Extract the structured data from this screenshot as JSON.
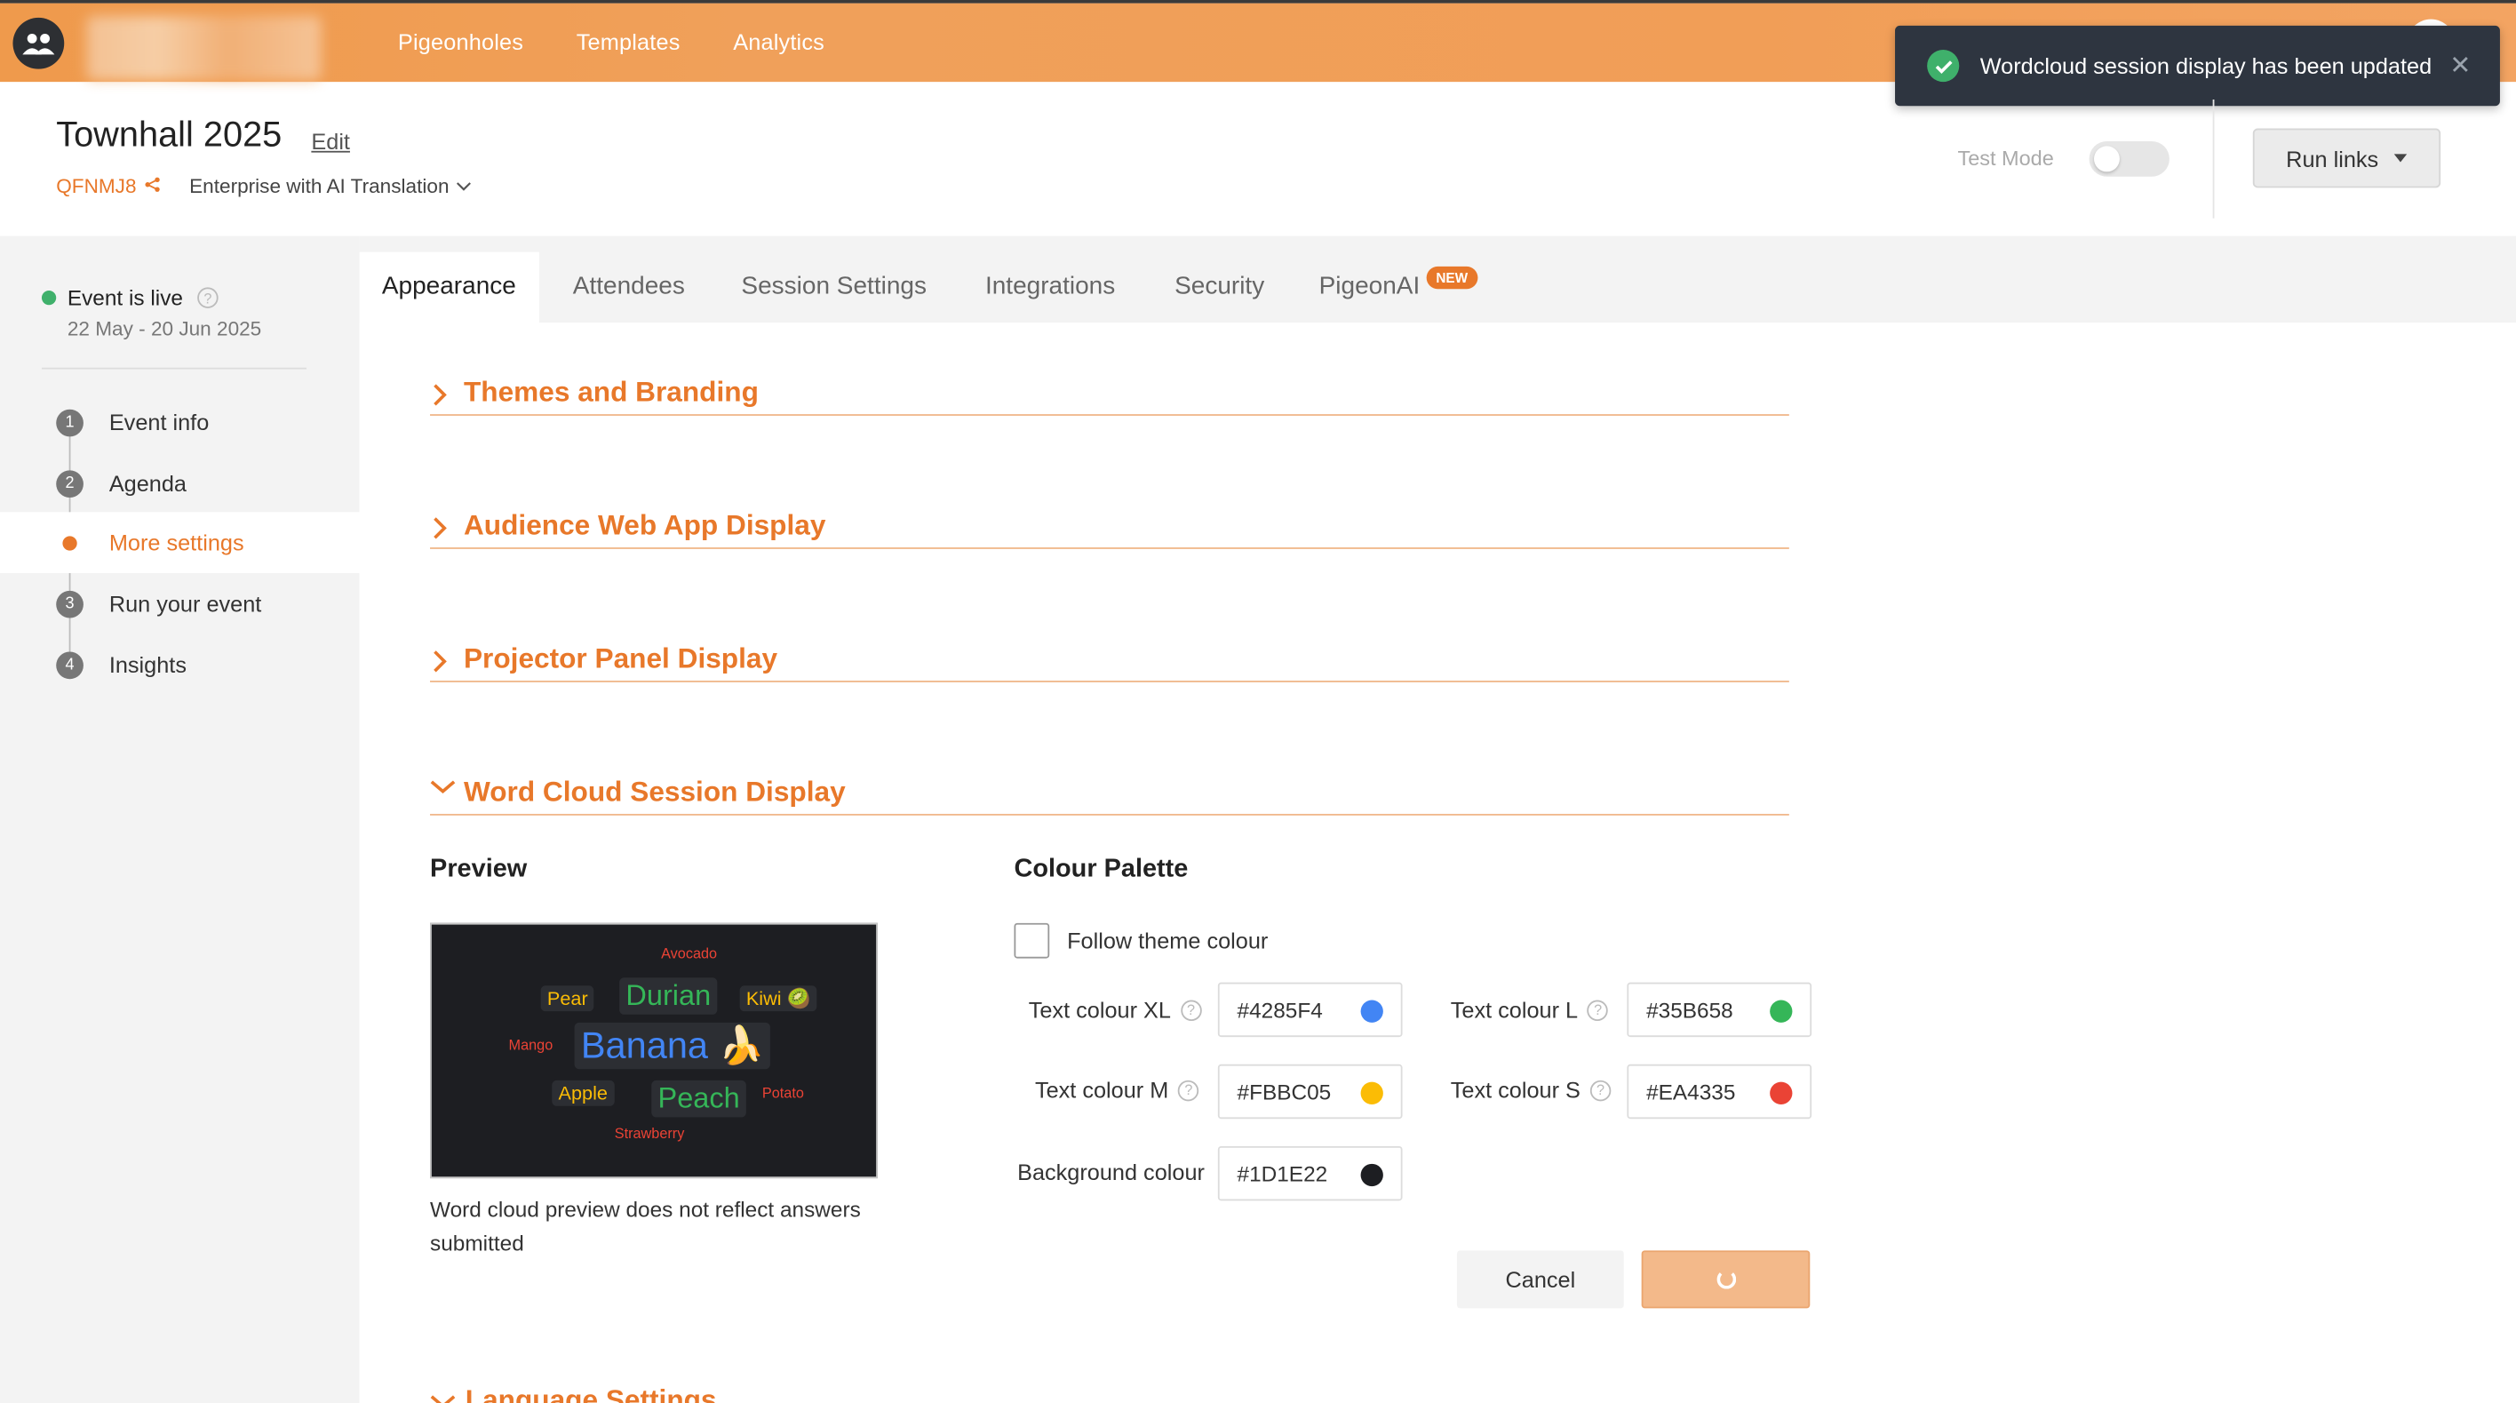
{
  "nav": {
    "items": [
      "Pigeonholes",
      "Templates",
      "Analytics"
    ]
  },
  "toast": {
    "message": "Wordcloud session display has been updated",
    "close": "✕"
  },
  "header": {
    "title": "Townhall 2025",
    "edit": "Edit",
    "code": "QFNMJ8",
    "plan": "Enterprise with AI Translation",
    "test_mode": "Test Mode",
    "test_mode_on": false,
    "run_links": "Run links"
  },
  "sidebar": {
    "status": "Event is live",
    "dates": "22 May - 20 Jun 2025",
    "steps": [
      {
        "num": "1",
        "label": "Event info"
      },
      {
        "num": "2",
        "label": "Agenda"
      },
      {
        "num": "",
        "label": "More settings"
      },
      {
        "num": "3",
        "label": "Run your event"
      },
      {
        "num": "4",
        "label": "Insights"
      }
    ]
  },
  "tabs": [
    {
      "label": "Appearance"
    },
    {
      "label": "Attendees"
    },
    {
      "label": "Session Settings"
    },
    {
      "label": "Integrations"
    },
    {
      "label": "Security"
    },
    {
      "label": "PigeonAI",
      "badge": "NEW"
    }
  ],
  "sections": [
    {
      "title": "Themes and Branding",
      "expanded": false
    },
    {
      "title": "Audience Web App Display",
      "expanded": false
    },
    {
      "title": "Projector Panel Display",
      "expanded": false
    },
    {
      "title": "Word Cloud Session Display",
      "expanded": true
    },
    {
      "title": "Language Settings",
      "expanded": true
    }
  ],
  "wordcloud": {
    "preview_title": "Preview",
    "note": "Word cloud preview does not reflect answers submitted",
    "words": {
      "avocado": "Avocado",
      "pear": "Pear",
      "durian": "Durian",
      "kiwi": "Kiwi 🥝",
      "mango": "Mango",
      "banana": "Banana 🍌",
      "apple": "Apple",
      "peach": "Peach",
      "potato": "Potato",
      "strawberry": "Strawberry"
    }
  },
  "palette": {
    "title": "Colour Palette",
    "follow_theme": "Follow theme colour",
    "follow_theme_checked": false,
    "fields": {
      "xl": {
        "label": "Text colour XL",
        "value": "#4285F4",
        "color": "#4285F4"
      },
      "l": {
        "label": "Text colour L",
        "value": "#35B658",
        "color": "#35B658"
      },
      "m": {
        "label": "Text colour M",
        "value": "#FBBC05",
        "color": "#FBBC05"
      },
      "s": {
        "label": "Text colour S",
        "value": "#EA4335",
        "color": "#EA4335"
      },
      "bg": {
        "label": "Background colour",
        "value": "#1D1E22",
        "color": "#1D1E22"
      }
    },
    "cancel": "Cancel"
  },
  "colors": {
    "brand": "#E8782A",
    "live": "#3FB06B"
  }
}
